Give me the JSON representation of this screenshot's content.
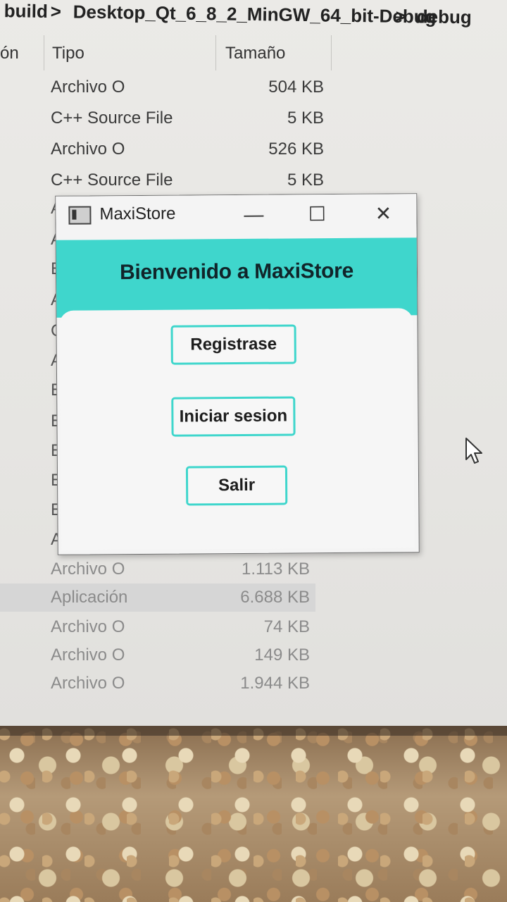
{
  "breadcrumb": {
    "segments": [
      "build",
      "Desktop_Qt_6_8_2_MinGW_64_bit-Debug",
      "debug"
    ],
    "separator": ">"
  },
  "columns": {
    "partial_left": "ón",
    "type": "Tipo",
    "size": "Tamaño"
  },
  "files_top": [
    {
      "type": "Archivo O",
      "size": "504 KB"
    },
    {
      "type": "C++ Source File",
      "size": "5 KB"
    },
    {
      "type": "Archivo O",
      "size": "526 KB"
    },
    {
      "type": "C++ Source File",
      "size": "5 KB"
    }
  ],
  "files_bottom": [
    {
      "type": "Archivo O",
      "size": "1.113 KB"
    },
    {
      "type": "Aplicación",
      "size": "6.688 KB",
      "selected": true
    },
    {
      "type": "Archivo O",
      "size": "74 KB"
    },
    {
      "type": "Archivo O",
      "size": "149 KB"
    },
    {
      "type": "Archivo O",
      "size": "1.944 KB"
    }
  ],
  "hidden_row_letters": [
    "A",
    "A",
    "E",
    "A",
    "C",
    "A",
    "E",
    "E",
    "E",
    "E",
    "E",
    "A"
  ],
  "dialog": {
    "title": "MaxiStore",
    "minimize": "—",
    "maximize": "☐",
    "close": "✕",
    "banner": "Bienvenido a MaxiStore",
    "buttons": {
      "register": "Registrase",
      "login": "Iniciar sesion",
      "exit": "Salir"
    }
  },
  "colors": {
    "accent": "#3fd6cc"
  }
}
